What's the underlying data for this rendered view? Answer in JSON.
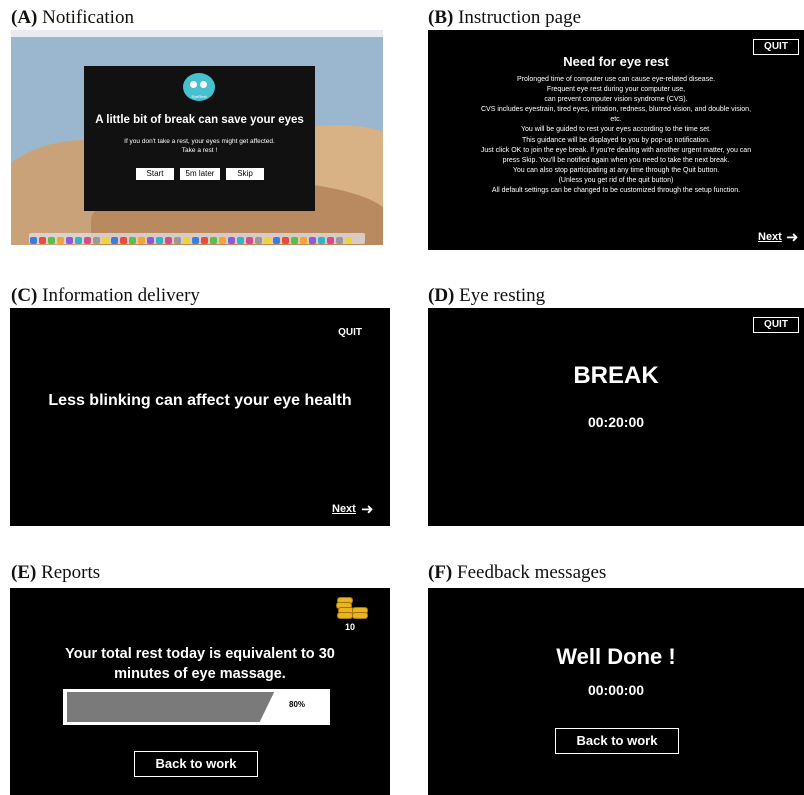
{
  "captions": {
    "a_letter": "(A)",
    "a_text": "Notification",
    "b_letter": "(B)",
    "b_text": "Instruction page",
    "c_letter": "(C)",
    "c_text": "Information delivery",
    "d_letter": "(D)",
    "d_text": "Eye resting",
    "e_letter": "(E)",
    "e_text": "Reports",
    "f_letter": "(F)",
    "f_text": "Feedback messages"
  },
  "notification": {
    "logo_label": "EyeRest",
    "headline": "A little bit of break can save your eyes",
    "sub_line1": "If you don't take a rest, your eyes might get affected.",
    "sub_line2": "Take a rest !",
    "start": "Start",
    "later": "5m later",
    "skip": "Skip"
  },
  "instruction": {
    "quit": "QUIT",
    "title": "Need for eye rest",
    "lines": [
      "Prolonged time of computer use can cause eye-related disease.",
      "Frequent eye rest during your computer use,",
      "can prevent computer vision syndrome (CVS).",
      "CVS includes eyestrain, tired eyes, irritation, redness, blurred vision, and double vision,",
      "etc.",
      "You will be guided to rest your eyes according to the time set.",
      "This guidance will be displayed to you by pop-up notification.",
      "Just click OK to join the eye break. If you're dealing with another urgent matter, you can",
      "press Skip. You'll be notified again when you need to take the next break.",
      "You can also stop participating at any time through the Quit button.",
      "(Unless you get rid of the quit button)",
      "All default settings can be changed to be customized through the setup function."
    ],
    "next": "Next"
  },
  "information": {
    "quit": "QUIT",
    "message": "Less blinking can affect your eye health",
    "next": "Next"
  },
  "resting": {
    "quit": "QUIT",
    "title": "BREAK",
    "timer": "00:20:00"
  },
  "reports": {
    "coin_count": "10",
    "message_line1": "Your total rest today is equivalent to 30",
    "message_line2": "minutes of eye massage.",
    "progress": 0.8,
    "progress_label": "80%",
    "back": "Back to work"
  },
  "feedback": {
    "title": "Well Done !",
    "timer": "00:00:00",
    "back": "Back to work"
  },
  "colors": {
    "panel_bg": "#000000",
    "logo": "#47c1cf",
    "progress_fill": "#7a7a7a",
    "coin": "#e8b422"
  }
}
